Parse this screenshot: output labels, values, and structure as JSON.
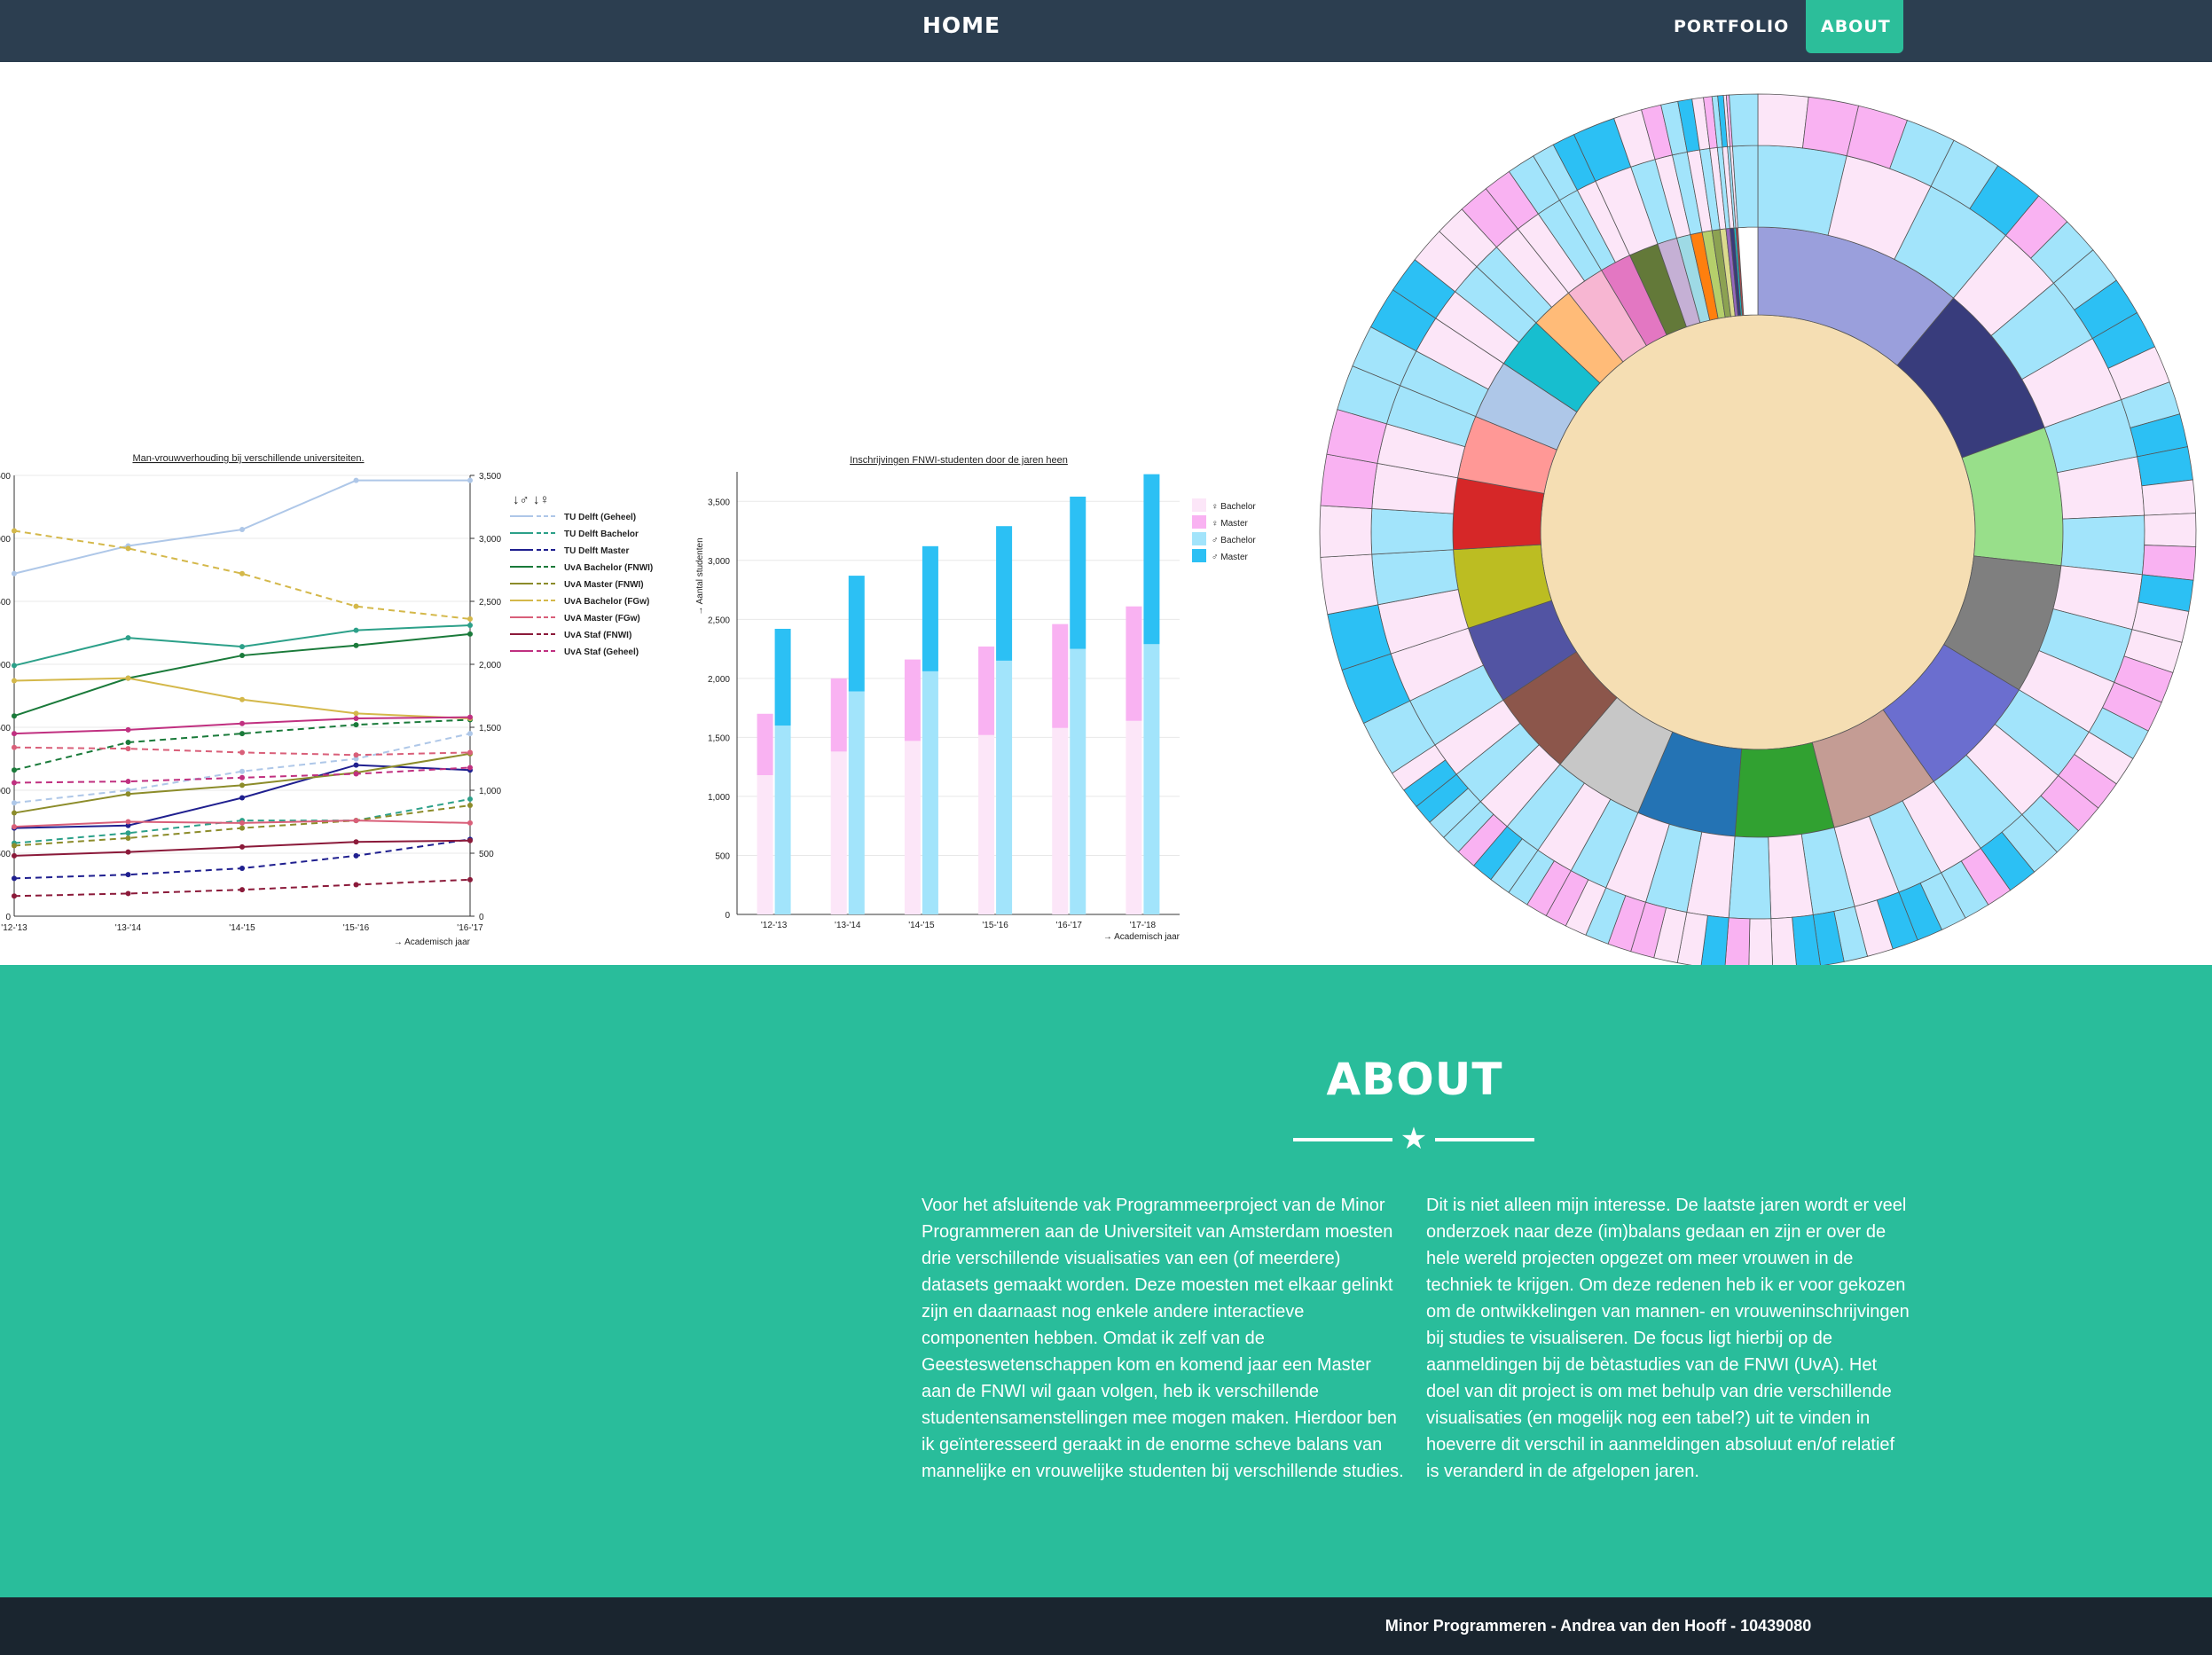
{
  "nav": {
    "brand": "HOME",
    "items": [
      {
        "label": "PORTFOLIO"
      },
      {
        "label": "ABOUT"
      }
    ],
    "colors": {
      "bar": "#2c3e50",
      "active": "#2cbe9a"
    }
  },
  "chart_data": [
    {
      "type": "line",
      "title": "Man-vrouwverhouding bij verschillende universiteiten.",
      "xlabel": "→ Academisch jaar",
      "categories": [
        "'12-'13",
        "'13-'14",
        "'14-'15",
        "'15-'16",
        "'16-'17"
      ],
      "ylim": [
        0,
        3500
      ],
      "yticks": [
        "0",
        "500",
        "1,000",
        "1,500",
        "2,000",
        "2,500",
        "3,000",
        "3,500"
      ],
      "legend_header": "↓♂ ↓♀",
      "series": [
        {
          "name": "TU Delft (Geheel)",
          "color": "#aec7e8",
          "values": [
            2720,
            2940,
            3070,
            3460,
            3460
          ],
          "female_values": [
            900,
            1000,
            1150,
            1250,
            1450
          ]
        },
        {
          "name": "TU Delft Bachelor",
          "color": "#2ca089",
          "values": [
            1990,
            2210,
            2140,
            2270,
            2310
          ],
          "female_values": [
            580,
            660,
            760,
            760,
            930
          ]
        },
        {
          "name": "TU Delft Master",
          "color": "#1f1f8f",
          "values": [
            700,
            720,
            940,
            1200,
            1160
          ],
          "female_values": [
            300,
            330,
            380,
            480,
            610
          ]
        },
        {
          "name": "UvA Bachelor (FNWI)",
          "color": "#1a7a3a",
          "values": [
            1590,
            1890,
            2070,
            2150,
            2240
          ],
          "female_values": [
            1160,
            1380,
            1450,
            1520,
            1560
          ]
        },
        {
          "name": "UvA Master (FNWI)",
          "color": "#8c8c2a",
          "values": [
            820,
            970,
            1040,
            1140,
            1290
          ],
          "female_values": [
            560,
            620,
            700,
            760,
            880
          ]
        },
        {
          "name": "UvA Bachelor (FGw)",
          "color": "#d4b84a",
          "values": [
            1870,
            1890,
            1720,
            1610,
            1570
          ],
          "female_values": [
            3060,
            2920,
            2720,
            2460,
            2360
          ]
        },
        {
          "name": "UvA Master (FGw)",
          "color": "#d95f79",
          "values": [
            710,
            750,
            740,
            760,
            740
          ],
          "female_values": [
            1340,
            1330,
            1300,
            1280,
            1300
          ]
        },
        {
          "name": "UvA Staf (FNWI)",
          "color": "#8b1a3a",
          "values": [
            480,
            510,
            550,
            590,
            600
          ],
          "female_values": [
            160,
            180,
            210,
            250,
            290
          ]
        },
        {
          "name": "UvA Staf (Geheel)",
          "color": "#c03080",
          "values": [
            1450,
            1480,
            1530,
            1570,
            1580
          ],
          "female_values": [
            1060,
            1070,
            1100,
            1130,
            1180
          ]
        }
      ]
    },
    {
      "type": "bar",
      "title": "Inschrijvingen FNWI-studenten door de jaren heen",
      "xlabel": "→ Academisch jaar",
      "ylabel": "→ Aantal studenten",
      "categories": [
        "'12-'13",
        "'13-'14",
        "'14-'15",
        "'15-'16",
        "'16-'17",
        "'17-'18"
      ],
      "ylim": [
        0,
        3750
      ],
      "yticks": [
        "0",
        "500",
        "1,000",
        "1,500",
        "2,000",
        "2,500",
        "3,000",
        "3,500"
      ],
      "series": [
        {
          "name": "♀ Bachelor",
          "color": "#fce6f8",
          "values": [
            1180,
            1380,
            1470,
            1520,
            1580,
            1640
          ]
        },
        {
          "name": "♀ Master",
          "color": "#f9b2f2",
          "values": [
            520,
            620,
            690,
            750,
            880,
            970
          ]
        },
        {
          "name": "♂ Bachelor",
          "color": "#a2e4fb",
          "values": [
            1600,
            1890,
            2060,
            2150,
            2250,
            2290
          ]
        },
        {
          "name": "♂ Master",
          "color": "#2cc0f4",
          "values": [
            820,
            980,
            1060,
            1140,
            1290,
            1440
          ]
        }
      ]
    },
    {
      "type": "sunburst",
      "inner_ring": [
        {
          "color": "#f5deb3",
          "value": 100
        }
      ],
      "middle_ring": [
        {
          "color": "#9a9fdc",
          "value": 10.6
        },
        {
          "color": "#383c7c",
          "value": 8.0
        },
        {
          "color": "#98df8a",
          "value": 7.0
        },
        {
          "color": "#7f7f7f",
          "value": 6.6
        },
        {
          "color": "#6b6ecf",
          "value": 6.3
        },
        {
          "color": "#c49c94",
          "value": 5.5
        },
        {
          "color": "#31a131",
          "value": 5.0
        },
        {
          "color": "#2473b4",
          "value": 5.0
        },
        {
          "color": "#c7c7c7",
          "value": 4.6
        },
        {
          "color": "#8c564b",
          "value": 4.3
        },
        {
          "color": "#5254a3",
          "value": 4.0
        },
        {
          "color": "#bcbd22",
          "value": 4.0
        },
        {
          "color": "#d62728",
          "value": 3.6
        },
        {
          "color": "#ff9896",
          "value": 3.2
        },
        {
          "color": "#aec7e8",
          "value": 3.0
        },
        {
          "color": "#17becf",
          "value": 2.6
        },
        {
          "color": "#ffbb78",
          "value": 2.2
        },
        {
          "color": "#f7b6d2",
          "value": 2.0
        },
        {
          "color": "#e377c2",
          "value": 1.6
        },
        {
          "color": "#637939",
          "value": 1.5
        },
        {
          "color": "#c5b0d5",
          "value": 1.0
        },
        {
          "color": "#9edae5",
          "value": 0.7
        },
        {
          "color": "#ff7f0e",
          "value": 0.6
        },
        {
          "color": "#b5cf6b",
          "value": 0.5
        },
        {
          "color": "#8ca252",
          "value": 0.4
        },
        {
          "color": "#dbdb8d",
          "value": 0.3
        },
        {
          "color": "#9467bd",
          "value": 0.2
        },
        {
          "color": "#393b79",
          "value": 0.2
        },
        {
          "color": "#17becf",
          "value": 0.1
        },
        {
          "color": "#ad494a",
          "value": 0.1
        },
        {
          "color": "#ffffff",
          "value": 1.0
        }
      ],
      "outer_palette": [
        "#fce6f8",
        "#f9b2f2",
        "#a2e4fb",
        "#2cc0f4"
      ]
    }
  ],
  "about": {
    "title": "ABOUT",
    "col_left": "Voor het afsluitende vak Programmeerproject van de Minor Programmeren aan de Universiteit van Amsterdam moesten drie verschillende visualisaties van een (of meerdere) datasets gemaakt worden. Deze moesten met elkaar gelinkt zijn en daarnaast nog enkele andere interactieve componenten hebben. Omdat ik zelf van de Geesteswetenschappen kom en komend jaar een Master aan de FNWI wil gaan volgen, heb ik verschillende studentensamenstellingen mee mogen maken. Hierdoor ben ik geïnteresseerd geraakt in de enorme scheve balans van mannelijke en vrouwelijke studenten bij verschillende studies.",
    "col_right": "Dit is niet alleen mijn interesse. De laatste jaren wordt er veel onderzoek naar deze (im)balans gedaan en zijn er over de hele wereld projecten opgezet om meer vrouwen in de techniek te krijgen. Om deze redenen heb ik er voor gekozen om de ontwikkelingen van mannen- en vrouweninschrijvingen bij studies te visualiseren. De focus ligt hierbij op de aanmeldingen bij de bètastudies van de FNWI (UvA). Het doel van dit project is om met behulp van drie verschillende visualisaties (en mogelijk nog een tabel?) uit te vinden in hoeverre dit verschil in aanmeldingen absoluut en/of relatief is veranderd in de afgelopen jaren.",
    "divider_icon": "star-icon",
    "background": "#29bd9b"
  },
  "footer": {
    "text": "Minor Programmeren - Andrea van den Hooff - 10439080"
  }
}
